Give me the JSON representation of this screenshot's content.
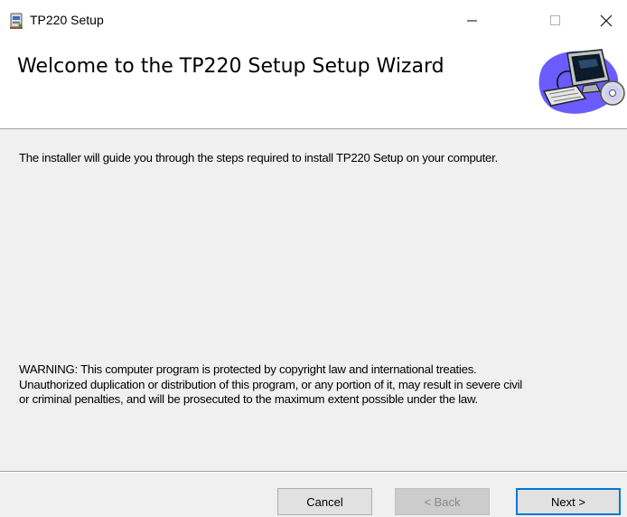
{
  "window": {
    "title": "TP220 Setup",
    "icon": "installer-icon",
    "controls": {
      "minimize": "minimize-icon",
      "maximize": "maximize-icon",
      "close": "close-icon"
    }
  },
  "banner": {
    "title": "Welcome to the TP220 Setup Setup Wizard",
    "graphic": "computer-cd-icon"
  },
  "body": {
    "intro": "The installer will guide you through the steps required to install TP220 Setup on your computer.",
    "warning_lines": [
      "WARNING: This computer program is protected by copyright law and international treaties.",
      "Unauthorized duplication or distribution of this program, or any portion of it, may result in severe civil",
      "or criminal penalties, and will be prosecuted to the maximum extent possible under the law."
    ]
  },
  "buttons": {
    "cancel": "Cancel",
    "back": "< Back",
    "next": "Next >"
  },
  "colors": {
    "focus_accent": "#0078d7",
    "dialog_background": "#f0f0f0",
    "banner_background": "#ffffff"
  }
}
